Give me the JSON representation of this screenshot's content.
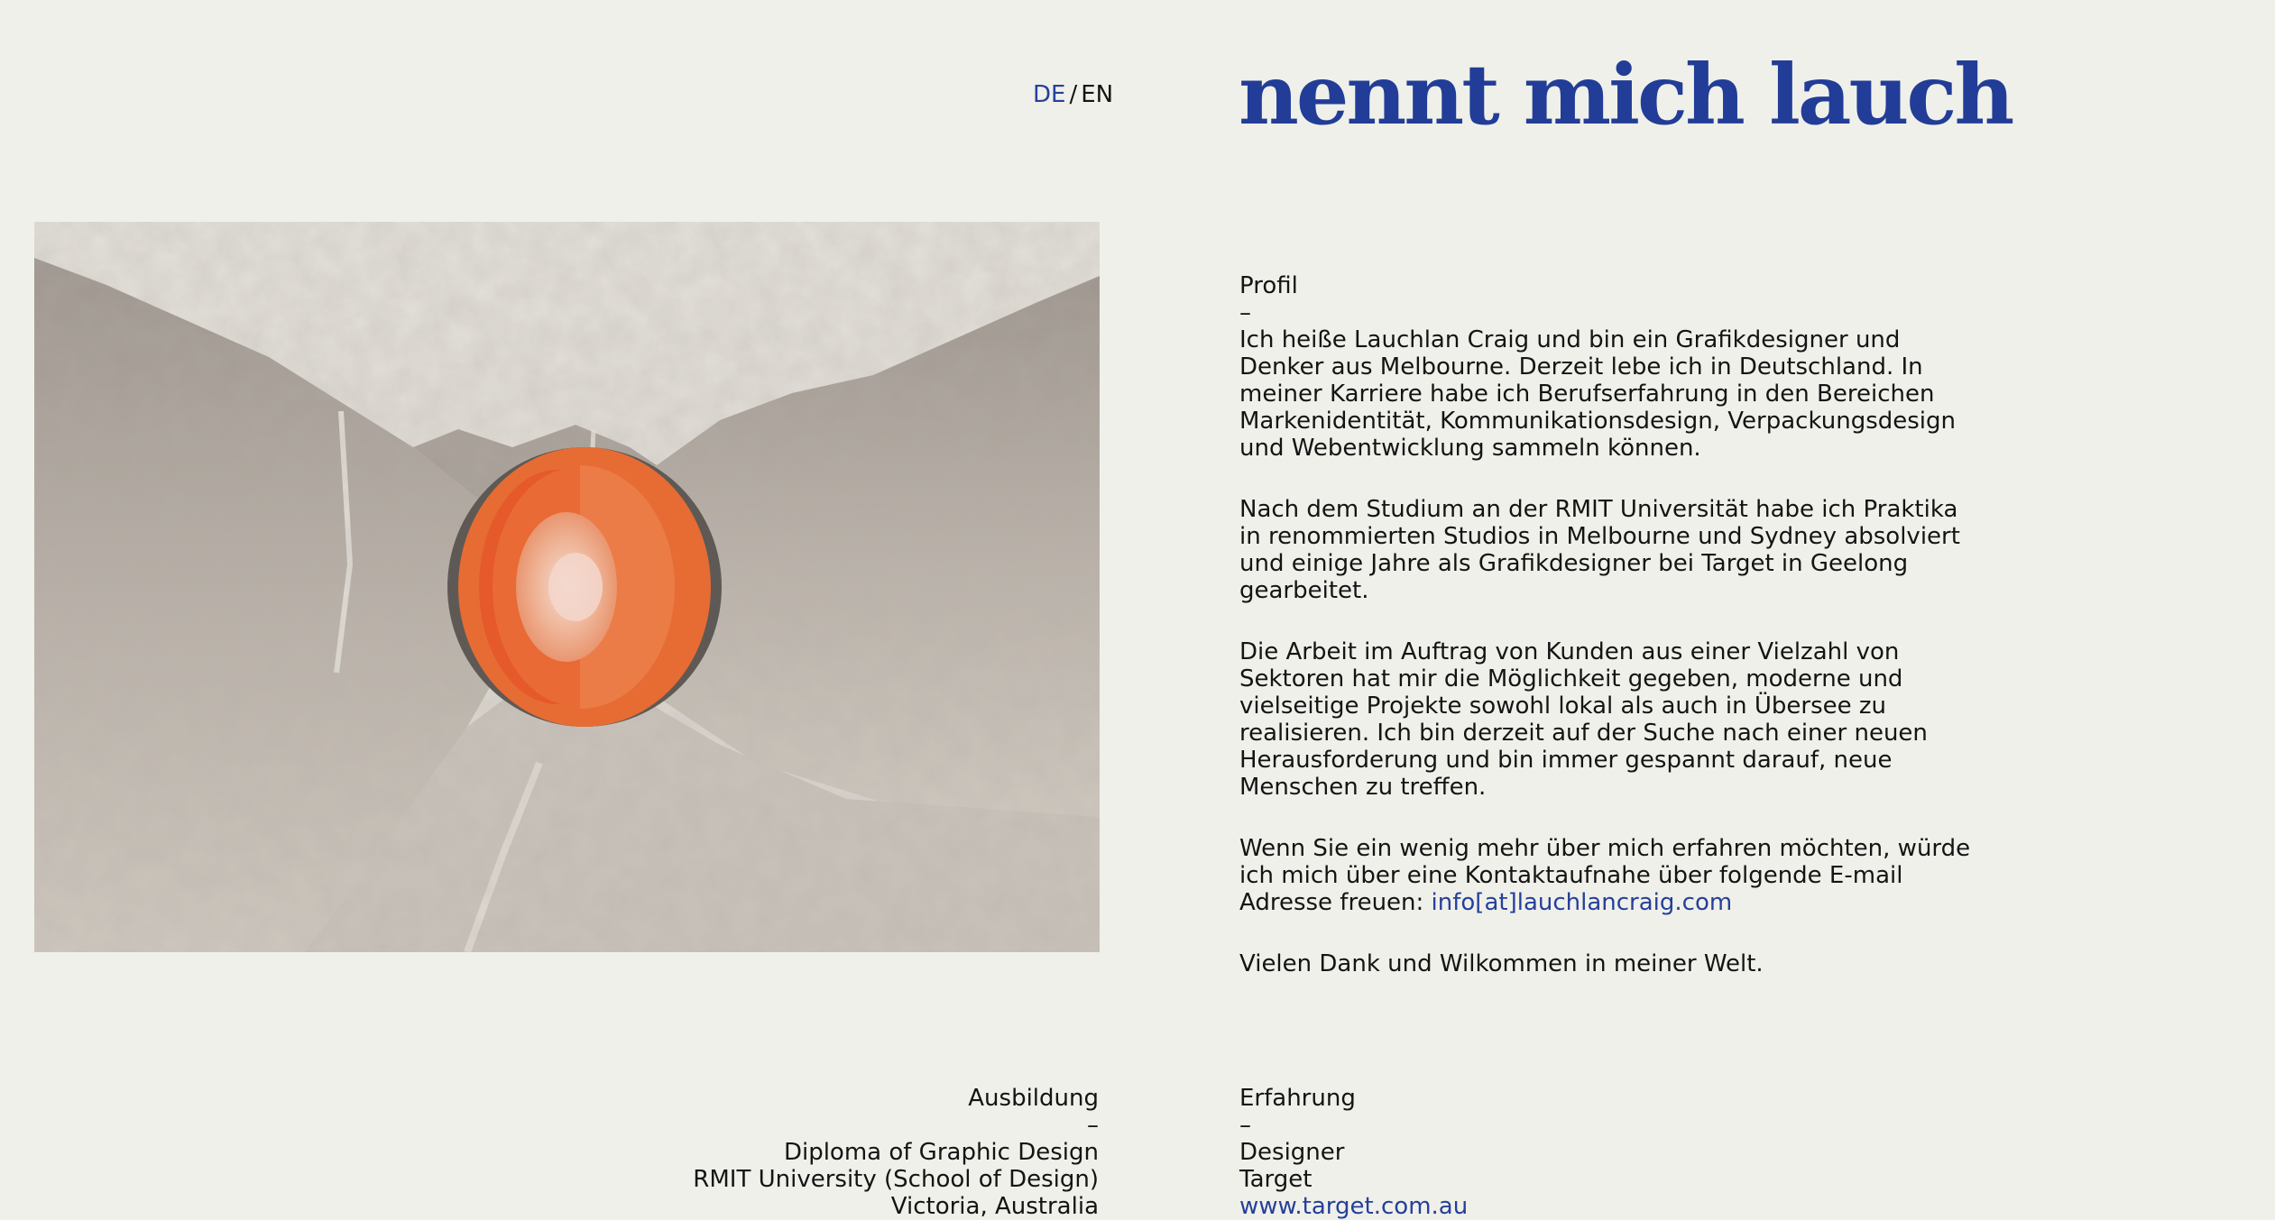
{
  "lang_switch": {
    "de": "DE",
    "separator": "/",
    "en": "EN"
  },
  "logo": {
    "text": "nennt mich lauch"
  },
  "hero": {
    "image": "mountain-landscape-with-earth-core-cutaway"
  },
  "profile": {
    "heading": "Profil",
    "dash": "–",
    "p1": "Ich heiße Lauchlan Craig und bin ein Grafikdesigner und Denker aus Melbourne. Derzeit lebe ich in Deutschland. In meiner Karriere habe ich Berufserfahrung in den Bereichen Markenidentität, Kommunikationsdesign, Verpackungsdesign und Webentwicklung sammeln können.",
    "p2": "Nach dem Studium an der RMIT Universität habe ich Praktika in renommierten Studios in Melbourne und Sydney absolviert und einige Jahre als Grafikdesigner bei Target in Geelong gearbeitet.",
    "p3": "Die Arbeit im Auftrag von Kunden aus einer Vielzahl von Sektoren hat mir die Möglichkeit gegeben, moderne und vielseitige Projekte sowohl lokal als auch in Übersee zu realisieren. Ich bin derzeit auf der Suche nach einer neuen Herausforderung und bin immer gespannt darauf, neue Menschen zu treffen.",
    "p4_text": "Wenn Sie ein wenig mehr über mich erfahren möchten, würde ich mich über eine Kontaktaufnahe über folgende E-mail Adresse freuen:",
    "email": "info[at]lauchlancraig.com",
    "p5": "Vielen Dank und Wilkommen in meiner Welt."
  },
  "education": {
    "heading": "Ausbildung",
    "dash": "–",
    "line1": "Diploma of Graphic Design",
    "line2": "RMIT University (School of Design)",
    "line3": "Victoria, Australia"
  },
  "experience": {
    "heading": "Erfahrung",
    "dash": "–",
    "line1": "Designer",
    "line2": "Target",
    "link": "www.target.com.au"
  },
  "colors": {
    "background": "#f0f0ea",
    "accent": "#25409a",
    "text": "#141414",
    "core_outer": "#e8692f",
    "core_inner": "#ee9d7a"
  }
}
